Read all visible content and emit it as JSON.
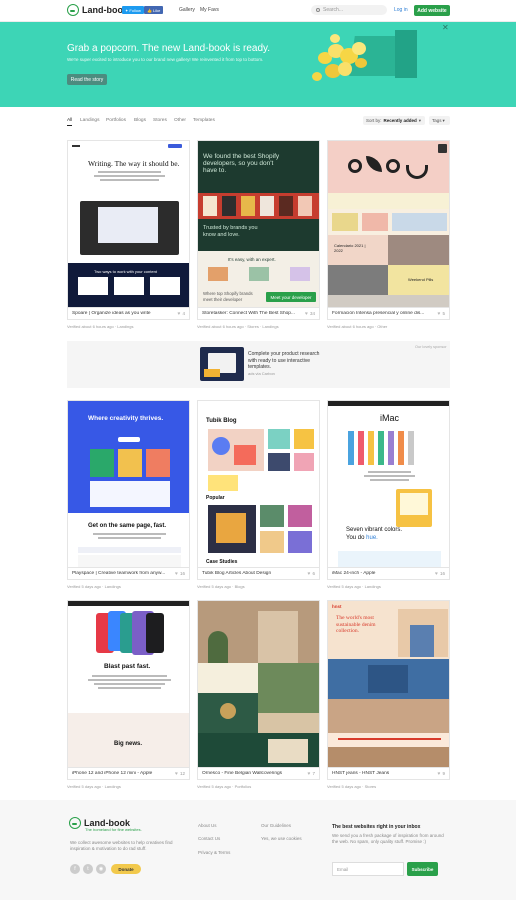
{
  "header": {
    "logo": "Land-book",
    "twitter": "Follow",
    "facebook": "Like",
    "nav": [
      "Gallery",
      "My Favs"
    ],
    "search_placeholder": "Search...",
    "login": "Log in",
    "add_website": "Add website"
  },
  "hero": {
    "title": "Grab a popcorn. The new Land-book is ready.",
    "subtitle": "We're super excited to introduce you to our brand new gallery! We reinvented it from top to bottom.",
    "cta": "Read the story",
    "close": "✕"
  },
  "filters": {
    "items": [
      "All",
      "Landings",
      "Portfolios",
      "Blogs",
      "Stores",
      "Other",
      "Templates"
    ],
    "sort_label": "Sort by:",
    "sort_value": "Recently added",
    "tags_label": "Tags"
  },
  "cards": [
    {
      "title": "Spoare | Organize ideas as you write",
      "likes": "4",
      "meta": "Verified about 6 hours ago · Landings",
      "shot": {
        "headline": "Writing. The way it should be.",
        "band": "Two ways to work with your content"
      }
    },
    {
      "title": "Storetasker: Connect With The Best Shop...",
      "likes": "34",
      "meta": "Verified about 6 hours ago · Stores · Landings",
      "shot": {
        "headline": "We found the best Shopify developers, so you don't have to.",
        "mid": "Trusted by brands you know and love.",
        "easy": "It's easy, with an expert.",
        "prompt": "Where top Shopify brands meet their developer",
        "button": "Meet your developer"
      }
    },
    {
      "title": "Formación Intensa presencial y online dis...",
      "likes": "5",
      "meta": "Verified about 6 hours ago · Other",
      "shot": {
        "cal": "Calendario 2021 | 2022",
        "weekend": "Weekend Pills"
      }
    },
    {
      "title": "Playspace | Creative teamwork from anyw...",
      "likes": "16",
      "meta": "Verified 5 days ago · Landings",
      "shot": {
        "headline": "Where creativity thrives.",
        "band": "Get on the same page, fast."
      }
    },
    {
      "title": "Tubik Blog Articles About Design",
      "likes": "6",
      "meta": "Verified 5 days ago · Blogs",
      "shot": {
        "headline": "Tubik Blog",
        "popular": "Popular",
        "case": "Case Studies"
      }
    },
    {
      "title": "iMac 24-inch - Apple",
      "likes": "16",
      "meta": "Verified 5 days ago · Landings",
      "shot": {
        "headline": "iMac",
        "colors": "Seven vibrant colors.",
        "you": "You do",
        "hue": "hue."
      }
    },
    {
      "title": "iPhone 12 and iPhone 12 mini - Apple",
      "likes": "12",
      "meta": "Verified 5 days ago · Landings",
      "shot": {
        "headline": "Blast past fast.",
        "band": "Big news."
      }
    },
    {
      "title": "Ornesco - Fine Belgian Wallcoverings",
      "likes": "7",
      "meta": "Verified 5 days ago · Portfolios",
      "shot": {}
    },
    {
      "title": "HNST jeans - HNST Jeans",
      "likes": "9",
      "meta": "Verified 5 days ago · Stores",
      "shot": {
        "brand": "hnst",
        "headline": "The world's most sustainable denim collection."
      }
    }
  ],
  "sponsor": {
    "text": "Complete your product research with ready to use interactive templates.",
    "via": "ads via Carbon",
    "tag": "Our lovely sponsor"
  },
  "footer": {
    "logo": "Land-book",
    "tagline": "The homeland for fine websites.",
    "desc": "We collect awesome websites to help creatives find inspiration & motivation to do rad stuff.",
    "donate": "Donate",
    "links_col1": [
      "About Us",
      "Contact Us",
      "Privacy & Terms"
    ],
    "links_col2": [
      "Our Guidelines",
      "Yes, we use cookies"
    ],
    "news_title": "The best websites right in your inbox",
    "news_text": "We send you a fresh package of inspiration from around the web. No spam, only quality stuff. Promise :)",
    "email_placeholder": "Email",
    "subscribe": "Subscribe"
  },
  "colors": {
    "accent": "#2aa04a",
    "hero_bg": "#3dd5b6",
    "link": "#2f7fd5"
  }
}
